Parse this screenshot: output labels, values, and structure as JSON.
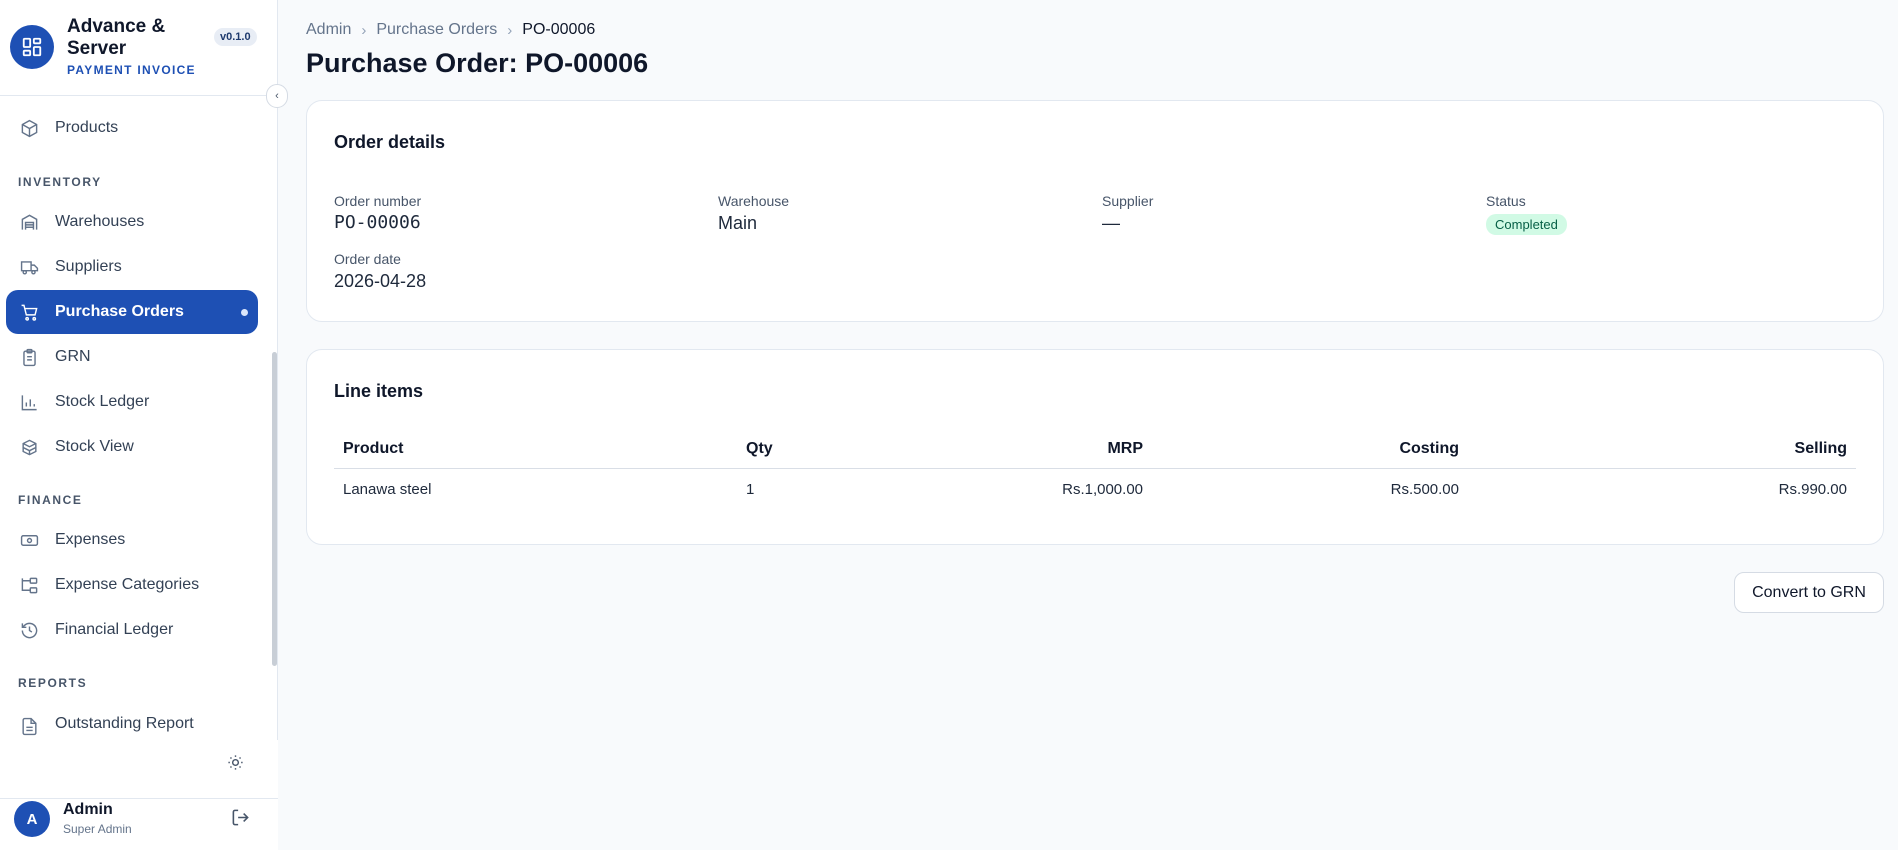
{
  "brand": {
    "name": "Advance & Server",
    "subtitle": "PAYMENT INVOICE",
    "version": "v0.1.0"
  },
  "sidebar": {
    "items_top": [
      {
        "label": "Products",
        "icon": "package-icon"
      }
    ],
    "sections": [
      {
        "label": "INVENTORY",
        "items": [
          {
            "label": "Warehouses",
            "icon": "warehouse-icon"
          },
          {
            "label": "Suppliers",
            "icon": "truck-icon"
          },
          {
            "label": "Purchase Orders",
            "icon": "cart-icon",
            "active": true
          },
          {
            "label": "GRN",
            "icon": "clipboard-icon"
          },
          {
            "label": "Stock Ledger",
            "icon": "bar-chart-icon"
          },
          {
            "label": "Stock View",
            "icon": "boxes-icon"
          }
        ]
      },
      {
        "label": "FINANCE",
        "items": [
          {
            "label": "Expenses",
            "icon": "banknote-icon"
          },
          {
            "label": "Expense Categories",
            "icon": "folder-tree-icon"
          },
          {
            "label": "Financial Ledger",
            "icon": "history-icon"
          }
        ]
      },
      {
        "label": "REPORTS",
        "items": [
          {
            "label": "Outstanding Report",
            "icon": "file-text-icon"
          }
        ]
      }
    ]
  },
  "user": {
    "initial": "A",
    "name": "Admin",
    "role": "Super Admin"
  },
  "breadcrumb": [
    "Admin",
    "Purchase Orders",
    "PO-00006"
  ],
  "page_title": "Purchase Order: PO-00006",
  "order_details": {
    "title": "Order details",
    "order_number_label": "Order number",
    "order_number": "PO-00006",
    "warehouse_label": "Warehouse",
    "warehouse": "Main",
    "supplier_label": "Supplier",
    "supplier": "—",
    "status_label": "Status",
    "status": "Completed",
    "order_date_label": "Order date",
    "order_date": "2026-04-28"
  },
  "line_items": {
    "title": "Line items",
    "columns": [
      "Product",
      "Qty",
      "MRP",
      "Costing",
      "Selling"
    ],
    "rows": [
      [
        "Lanawa steel",
        "1",
        "Rs.1,000.00",
        "Rs.500.00",
        "Rs.990.00"
      ]
    ]
  },
  "actions": {
    "convert_label": "Convert to GRN"
  },
  "colors": {
    "accent": "#1e50b4",
    "status_bg": "#d1fae5",
    "status_text": "#065f46"
  }
}
